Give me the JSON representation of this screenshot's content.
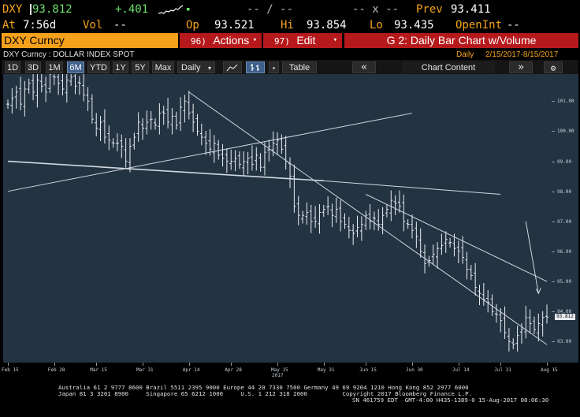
{
  "header": {
    "ticker": "DXY",
    "price": "93.812",
    "change": "+.401",
    "vol_label": "Vol",
    "vol_value": "--",
    "dash_slash": "-- / --",
    "x_label": "-- x --",
    "prev_label": "Prev",
    "prev_value": "93.411",
    "at_label": "At",
    "at_time": "7:56d",
    "op_label": "Op",
    "op_value": "93.521",
    "hi_label": "Hi",
    "hi_value": "93.854",
    "lo_label": "Lo",
    "lo_value": "93.435",
    "openint_label": "OpenInt",
    "openint_value": "--"
  },
  "command_bar": {
    "security": "DXY Curncy",
    "actions_num": "96)",
    "actions_label": "Actions",
    "edit_num": "97)",
    "edit_label": "Edit",
    "chart_title": "G 2: Daily Bar Chart w/Volume"
  },
  "subheader": {
    "description": "DXY Curncy : DOLLAR INDEX SPOT",
    "period": "Daily",
    "range": "2/15/2017-8/15/2017"
  },
  "toolbar": {
    "ranges": [
      "1D",
      "3D",
      "1M",
      "6M",
      "YTD",
      "1Y",
      "5Y",
      "Max"
    ],
    "active_range": "6M",
    "frequency": "Daily",
    "table_label": "Table",
    "chart_content": "Chart Content"
  },
  "chart_data": {
    "type": "bar",
    "series_type": "ohlc",
    "y_ticks": [
      93.0,
      94.0,
      95.0,
      96.0,
      97.0,
      98.0,
      99.0,
      100.0,
      101.0
    ],
    "y_tick_labels": [
      "93.00",
      "94.00",
      "95.00",
      "96.00",
      "97.00",
      "98.00",
      "99.00",
      "100.00",
      "101.00"
    ],
    "ylim": [
      92.3,
      101.9
    ],
    "last_price_label": "93.812",
    "x_tick_labels": [
      "Feb 15",
      "Feb 28",
      "Mar 15",
      "Mar 31",
      "Apr 14",
      "Apr 28",
      "May 15",
      "May 31",
      "Jun 15",
      "Jun 30",
      "Jul 14",
      "Jul 31",
      "Aug 15"
    ],
    "year_label": "2017",
    "closes": [
      100.9,
      101.1,
      101.3,
      100.9,
      101.4,
      101.6,
      101.3,
      101.7,
      101.5,
      101.3,
      101.9,
      101.8,
      101.6,
      101.4,
      101.7,
      101.8,
      101.5,
      101.6,
      101.2,
      101.0,
      100.4,
      100.1,
      100.3,
      99.8,
      99.7,
      99.6,
      99.6,
      99.5,
      99.0,
      99.5,
      99.8,
      100.3,
      100.1,
      100.3,
      100.4,
      100.2,
      100.6,
      100.6,
      100.3,
      100.5,
      100.2,
      100.8,
      101.0,
      100.6,
      100.3,
      100.0,
      99.8,
      99.6,
      99.4,
      99.6,
      99.2,
      99.1,
      99.0,
      99.0,
      99.1,
      98.9,
      99.0,
      99.1,
      98.9,
      99.2,
      98.8,
      99.3,
      99.5,
      99.6,
      99.7,
      99.4,
      99.0,
      98.5,
      97.5,
      97.2,
      97.2,
      97.3,
      97.0,
      97.0,
      97.3,
      97.4,
      97.5,
      97.2,
      97.4,
      97.0,
      96.9,
      96.7,
      96.6,
      96.8,
      96.9,
      97.2,
      97.0,
      97.1,
      96.9,
      97.2,
      97.4,
      97.7,
      97.6,
      97.5,
      97.0,
      96.9,
      96.7,
      96.5,
      96.0,
      95.6,
      95.7,
      95.9,
      96.1,
      96.2,
      96.4,
      96.3,
      96.1,
      96.0,
      95.8,
      95.4,
      95.2,
      94.8,
      94.6,
      94.4,
      94.3,
      94.0,
      93.9,
      93.7,
      93.3,
      93.0,
      92.9,
      93.2,
      93.4,
      93.8,
      93.6,
      93.4,
      93.6,
      93.8,
      93.812
    ],
    "trendlines": [
      {
        "from": [
          "Feb 15",
          99.0
        ],
        "to": [
          "May 31",
          98.35
        ]
      },
      {
        "from": [
          "May 31",
          98.35
        ],
        "to": [
          "Jul 31",
          97.9
        ]
      },
      {
        "from": [
          "Feb 15",
          98.0
        ],
        "to": [
          "Jun 30",
          100.6
        ]
      },
      {
        "from": [
          "Apr 14",
          101.3
        ],
        "to": [
          "Aug 15",
          92.9
        ]
      },
      {
        "from": [
          "Jun 15",
          97.9
        ],
        "to": [
          "Aug 15",
          95.0
        ]
      }
    ],
    "arrow": {
      "from": [
        "Aug 8",
        97.0
      ],
      "to": [
        "Aug 12",
        94.6
      ]
    }
  },
  "footer": {
    "line1": "Australia 61 2 9777 8600 Brazil 5511 2395 9000 Europe 44 20 7330 7500 Germany 49 69 9204 1210 Hong Kong 852 2977 6000",
    "line2": "Japan 81 3 3201 8900     Singapore 65 6212 1000     U.S. 1 212 318 2000          Copyright 2017 Bloomberg Finance L.P.",
    "line3": "SN 461759 EDT  GMT-4:00 H435-1389-0 15-Aug-2017 08:06:30"
  },
  "colors": {
    "amber": "#f4a31c",
    "orange_bar": "#f6a11b",
    "red_bar": "#b6191c",
    "chart_bg": "#243342",
    "bar_color": "#e8edf2"
  }
}
